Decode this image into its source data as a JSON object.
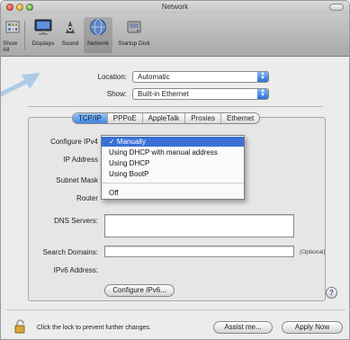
{
  "window": {
    "title": "Network"
  },
  "toolbar": {
    "items": [
      {
        "label": "Show All",
        "icon": "grid-icon"
      },
      {
        "label": "Displays",
        "icon": "display-icon"
      },
      {
        "label": "Sound",
        "icon": "speaker-icon"
      },
      {
        "label": "Network",
        "icon": "globe-icon",
        "selected": true
      },
      {
        "label": "Startup Disk",
        "icon": "disk-icon"
      }
    ]
  },
  "location": {
    "label": "Location:",
    "value": "Automatic"
  },
  "show": {
    "label": "Show:",
    "value": "Built-in Ethernet"
  },
  "tabs": [
    {
      "label": "TCP/IP",
      "active": true
    },
    {
      "label": "PPPoE"
    },
    {
      "label": "AppleTalk"
    },
    {
      "label": "Proxies"
    },
    {
      "label": "Ethernet"
    }
  ],
  "form": {
    "configure_ipv4": "Configure IPv4",
    "ip_address": "IP Address",
    "subnet_mask": "Subnet Mask",
    "router": "Router",
    "dns_servers": "DNS Servers:",
    "search_domains": "Search Domains:",
    "optional": "(Optional)",
    "ipv6_address": "IPv6 Address:",
    "configure_ipv6_button": "Configure IPv6...",
    "help": "?"
  },
  "ipv4_menu": {
    "items": [
      {
        "label": "✓ Manually",
        "selected": true
      },
      {
        "label": "Using DHCP with manual address"
      },
      {
        "label": "Using DHCP"
      },
      {
        "label": "Using BootP"
      },
      {
        "label": "Off"
      }
    ]
  },
  "footer": {
    "lock_text": "Click the lock to prevent further changes.",
    "assist_button": "Assist me...",
    "apply_button": "Apply Now"
  },
  "colors": {
    "accent": "#3a6fd8",
    "arrow": "#a9c9e6"
  }
}
